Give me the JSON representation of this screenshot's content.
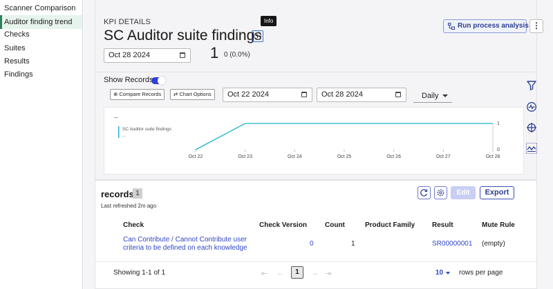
{
  "sidebar": {
    "items": [
      {
        "label": "Scanner Comparison",
        "active": false
      },
      {
        "label": "Auditor finding trend",
        "active": true
      },
      {
        "label": "Checks",
        "active": false
      },
      {
        "label": "Suites",
        "active": false
      },
      {
        "label": "Results",
        "active": false
      },
      {
        "label": "Findings",
        "active": false
      }
    ]
  },
  "header": {
    "kpi_label": "KPI DETAILS",
    "title": "SC Auditor suite findings",
    "tooltip": "Info",
    "date": "Oct 28 2024",
    "big_value": "1",
    "small_value": "0 (0.0%)",
    "run_button": "Run process analysis",
    "more_button": "⋮"
  },
  "chart_controls": {
    "show_records_label": "Show Records",
    "show_records_on": true,
    "compare_button": "Compare Records",
    "chart_options_button": "Chart Options",
    "start_date": "Oct 22 2024",
    "end_date": "Oct 28 2024",
    "interval": "Daily"
  },
  "chart_data": {
    "type": "line",
    "title": "--",
    "legend": {
      "name": "SC Auditor suite findings",
      "value": "--"
    },
    "x": [
      "Oct 22",
      "Oct 23",
      "Oct 24",
      "Oct 25",
      "Oct 26",
      "Oct 27",
      "Oct 28"
    ],
    "series": [
      {
        "name": "SC Auditor suite findings",
        "values": [
          0,
          1,
          1,
          1,
          1,
          1,
          1
        ]
      }
    ],
    "y_right_ticks": [
      "1",
      "0"
    ],
    "ylim": [
      0,
      1
    ],
    "color": "#1fb3d1"
  },
  "rail_icons": [
    "filter-icon",
    "pulse-icon",
    "crosshair-icon",
    "trend-compare-icon"
  ],
  "records": {
    "title": "records",
    "count": "1",
    "last_refreshed": "Last refreshed 2m ago",
    "edit_button": "Edit",
    "export_button": "Export",
    "columns": [
      "Check",
      "Check Version",
      "Count",
      "Product Family",
      "Result",
      "Mute Rule"
    ],
    "rows": [
      {
        "check": "Can Contribute / Cannot Contribute user criteria to be defined on each knowledge",
        "check_version": "0",
        "count": "1",
        "product_family": "",
        "result": "SR00000001",
        "mute_rule": "(empty)"
      }
    ],
    "pagination": {
      "showing": "Showing 1-1 of 1",
      "page": "1",
      "rows_per_page": "10",
      "rows_per_page_label": "rows per page"
    }
  }
}
